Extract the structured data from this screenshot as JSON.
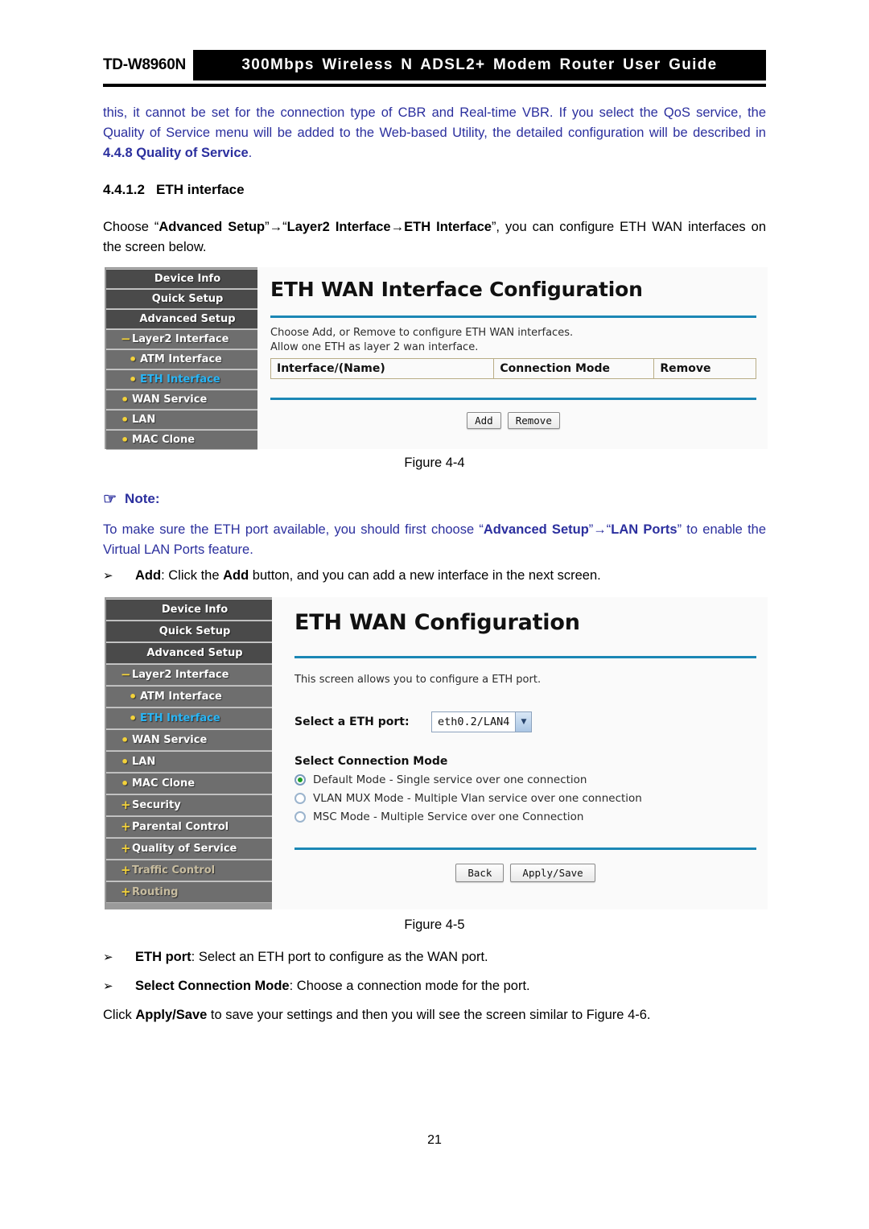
{
  "header": {
    "model": "TD-W8960N",
    "title": "300Mbps Wireless N ADSL2+ Modem Router User Guide"
  },
  "intro_paragraph": {
    "line1": "this, it cannot be set for the connection type of CBR and Real-time VBR. If you select the QoS",
    "line2": "service, the Quality of Service menu will be added to the Web-based Utility, the detailed",
    "line3_pre": "configuration will be described in ",
    "line3_bold": "4.4.8 Quality of Service",
    "line3_post": "."
  },
  "section": {
    "number": "4.4.1.2",
    "title": "ETH interface"
  },
  "choose_paragraph": {
    "pre": "Choose “",
    "b1": "Advanced Setup",
    "mid1": "”→“",
    "b2": "Layer2 Interface",
    "mid2": "→",
    "b3": "ETH Interface",
    "post": "”, you can configure ETH WAN interfaces on the screen below."
  },
  "figure4_4": {
    "caption": "Figure 4-4",
    "sidebar": [
      {
        "label": "Device Info",
        "level": 0,
        "marker": "",
        "state": "normal"
      },
      {
        "label": "Quick Setup",
        "level": 0,
        "marker": "",
        "state": "normal"
      },
      {
        "label": "Advanced Setup",
        "level": 0,
        "marker": "",
        "state": "normal"
      },
      {
        "label": "Layer2 Interface",
        "level": 1,
        "marker": "−",
        "state": "normal"
      },
      {
        "label": "ATM Interface",
        "level": 2,
        "marker": "•",
        "state": "normal"
      },
      {
        "label": "ETH Interface",
        "level": 2,
        "marker": "•",
        "state": "active"
      },
      {
        "label": "WAN Service",
        "level": 1,
        "marker": "•",
        "state": "normal"
      },
      {
        "label": "LAN",
        "level": 1,
        "marker": "•",
        "state": "normal"
      },
      {
        "label": "MAC Clone",
        "level": 1,
        "marker": "•",
        "state": "normal"
      }
    ],
    "panel_title": "ETH WAN Interface Configuration",
    "desc_line1": "Choose Add, or Remove to configure ETH WAN interfaces.",
    "desc_line2": "Allow one ETH as layer 2 wan interface.",
    "table_headers": [
      "Interface/(Name)",
      "Connection Mode",
      "Remove"
    ],
    "table_rows": [],
    "buttons": [
      "Add",
      "Remove"
    ]
  },
  "note": {
    "icon": "pointing-hand-icon",
    "label": "Note:",
    "line1_pre": "To make sure the ETH port available, you should first choose “",
    "line1_b1": "Advanced Setup",
    "line1_mid": "”→“",
    "line1_b2": "LAN Ports",
    "line1_post": "” to",
    "line2": "enable the Virtual LAN Ports feature."
  },
  "add_bullet": {
    "arrow": "➢",
    "b1": "Add",
    "mid": ": Click the ",
    "b2": "Add",
    "post": " button, and you can add a new interface in the next screen."
  },
  "figure4_5": {
    "caption": "Figure 4-5",
    "sidebar": [
      {
        "label": "Device Info",
        "level": 0,
        "marker": "",
        "state": "normal"
      },
      {
        "label": "Quick Setup",
        "level": 0,
        "marker": "",
        "state": "normal"
      },
      {
        "label": "Advanced Setup",
        "level": 0,
        "marker": "",
        "state": "normal"
      },
      {
        "label": "Layer2 Interface",
        "level": 1,
        "marker": "−",
        "state": "normal"
      },
      {
        "label": "ATM Interface",
        "level": 2,
        "marker": "•",
        "state": "normal"
      },
      {
        "label": "ETH Interface",
        "level": 2,
        "marker": "•",
        "state": "active"
      },
      {
        "label": "WAN Service",
        "level": 1,
        "marker": "•",
        "state": "normal"
      },
      {
        "label": "LAN",
        "level": 1,
        "marker": "•",
        "state": "normal"
      },
      {
        "label": "MAC Clone",
        "level": 1,
        "marker": "•",
        "state": "normal"
      },
      {
        "label": "Security",
        "level": 1,
        "marker": "+",
        "state": "normal"
      },
      {
        "label": "Parental Control",
        "level": 1,
        "marker": "+",
        "state": "normal"
      },
      {
        "label": "Quality of Service",
        "level": 1,
        "marker": "+",
        "state": "normal"
      },
      {
        "label": "Traffic Control",
        "level": 1,
        "marker": "+",
        "state": "tan"
      },
      {
        "label": "Routing",
        "level": 1,
        "marker": "+",
        "state": "tan"
      }
    ],
    "panel_title": "ETH WAN Configuration",
    "desc_line1": "This screen allows you to configure a ETH port.",
    "port_label": "Select a ETH port:",
    "port_value": "eth0.2/LAN4",
    "mode_title": "Select Connection Mode",
    "modes": [
      {
        "label": "Default Mode - Single service over one connection",
        "selected": true
      },
      {
        "label": "VLAN MUX Mode - Multiple Vlan service over one connection",
        "selected": false
      },
      {
        "label": "MSC Mode - Multiple Service over one Connection",
        "selected": false
      }
    ],
    "buttons": [
      "Back",
      "Apply/Save"
    ]
  },
  "bottom_bullets": {
    "b1": {
      "arrow": "➢",
      "bold": "ETH port",
      "text": ": Select an ETH port to configure as the WAN port."
    },
    "b2": {
      "arrow": "➢",
      "bold": "Select Connection Mode",
      "text": ": Choose a connection mode for the port."
    }
  },
  "closing_paragraph": {
    "pre": "Click ",
    "bold": "Apply/Save",
    "post": " to save your settings and then you will see the screen similar to Figure 4-6."
  },
  "page_number": "21",
  "colors": {
    "body_text_blue": "#2b2f9e",
    "sidebar_dark": "#4a4a4a",
    "sidebar_light": "#6e6e6e",
    "sidebar_outer": "#9a9a9a",
    "active_link": "#29b6f6",
    "bullet_yellow": "#f3d23a",
    "panel_rule": "#1b87b5",
    "table_border": "#b9ad86",
    "radio_selected": "#1c9e28"
  }
}
